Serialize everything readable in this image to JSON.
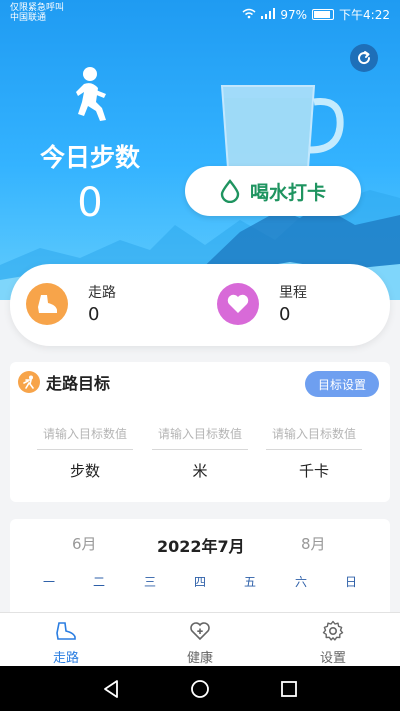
{
  "status_bar": {
    "left_line1": "仅限紧急呼叫",
    "left_line2": "中国联通",
    "battery": "97%",
    "time": "下午4:22"
  },
  "header": {
    "steps_title": "今日步数",
    "steps_value": "0",
    "water_button_label": "喝水打卡",
    "refresh_icon": "refresh-icon",
    "runner_icon": "runner-icon"
  },
  "stats": {
    "walk_label": "走路",
    "walk_value": "0",
    "distance_label": "里程",
    "distance_value": "0"
  },
  "goal": {
    "title": "走路目标",
    "settings_button": "目标设置",
    "fields": [
      {
        "placeholder": "请输入目标数值",
        "unit": "步数"
      },
      {
        "placeholder": "请输入目标数值",
        "unit": "米"
      },
      {
        "placeholder": "请输入目标数值",
        "unit": "千卡"
      }
    ]
  },
  "calendar": {
    "prev_month": "6月",
    "current_month": "2022年7月",
    "next_month": "8月",
    "weekdays": [
      "一",
      "二",
      "三",
      "四",
      "五",
      "六",
      "日"
    ]
  },
  "bottom_nav": {
    "items": [
      {
        "label": "走路",
        "icon": "shoe-icon",
        "active": true
      },
      {
        "label": "健康",
        "icon": "heart-plus-icon",
        "active": false
      },
      {
        "label": "设置",
        "icon": "gear-icon",
        "active": false
      }
    ]
  },
  "colors": {
    "sky_top": "#1f9bf2",
    "accent_orange": "#f7a44a",
    "accent_pink": "#d86ad8",
    "water_green": "#1f9460",
    "nav_active": "#2a7de1"
  }
}
